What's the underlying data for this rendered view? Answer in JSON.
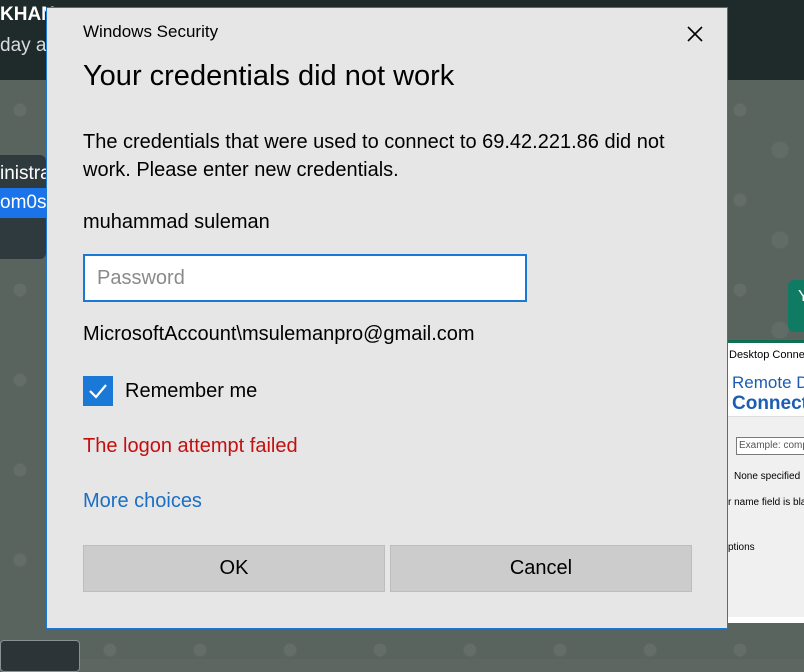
{
  "background": {
    "chat_header_name": "KHAN",
    "chat_header_sub": "day at",
    "bubble_line1": "inistrat",
    "bubble_line2": "om0s",
    "right_bubble_text": "Y",
    "rdp": {
      "title": "Desktop Connection",
      "banner_line1": "Remote Desktop",
      "banner_line2": "Connection",
      "computer_placeholder": "Example: computer.fabrikam.com",
      "user_status": "None specified",
      "blank_note": "r name field is blank",
      "options_label": "ptions"
    }
  },
  "dialog": {
    "window_title": "Windows Security",
    "heading": "Your credentials did not work",
    "message": "The credentials that were used to connect to 69.42.221.86 did not work. Please enter new credentials.",
    "username": "muhammad suleman",
    "password": {
      "value": "",
      "placeholder": "Password"
    },
    "account": "MicrosoftAccount\\msulemanpro@gmail.com",
    "remember_me": {
      "label": "Remember me",
      "checked": true
    },
    "error": "The logon attempt failed",
    "more_choices": "More choices",
    "ok_label": "OK",
    "cancel_label": "Cancel",
    "icons": {
      "close": "close-icon",
      "check": "checkmark-icon"
    },
    "colors": {
      "accent": "#1a78d6",
      "error": "#c50f0f",
      "link": "#1a6fc4",
      "dialog_bg": "#e6e6e6"
    }
  }
}
